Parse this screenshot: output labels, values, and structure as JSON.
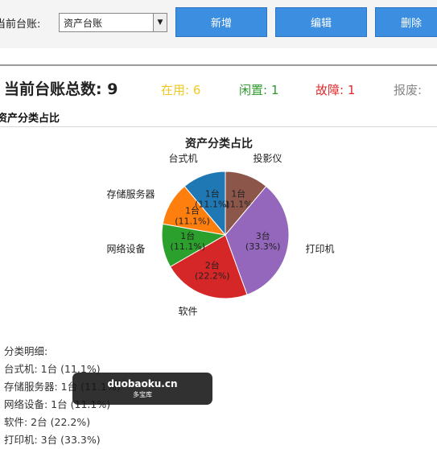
{
  "toolbar": {
    "ledger_label": "当前台账:",
    "ledger_select_value": "资产台账",
    "add_button": "新增",
    "edit_button": "编辑",
    "delete_button": "删除"
  },
  "stats": {
    "total": "当前台账总数: 9",
    "in_use": "在用: 6",
    "idle": "闲置: 1",
    "fault": "故障: 1",
    "scrap": "报废:",
    "colors": {
      "in_use": "#f2c81e",
      "idle": "#2e9a2e",
      "fault": "#e02a2a",
      "scrap": "#888888"
    }
  },
  "section_title": "资产分类占比",
  "chart_data": {
    "type": "pie",
    "title": "资产分类占比",
    "categories": [
      "投影仪",
      "打印机",
      "软件",
      "网络设备",
      "存储服务器",
      "台式机"
    ],
    "values": [
      1,
      3,
      2,
      1,
      1,
      1
    ],
    "slice_text": [
      [
        "1台",
        "(11.1%)"
      ],
      [
        "3台",
        "(33.3%)"
      ],
      [
        "2台",
        "(22.2%)"
      ],
      [
        "1台",
        "(11.1%)"
      ],
      [
        "1台",
        "(11.1%)"
      ],
      [
        "1台",
        "(11.1%)"
      ]
    ],
    "colors": [
      "#8c564b",
      "#9467bd",
      "#d62728",
      "#2ca02c",
      "#ff7f0e",
      "#1f77b4"
    ]
  },
  "detail": {
    "heading": "分类明细:",
    "lines": [
      "台式机: 1台 (11.1%)",
      "存储服务器: 1台 (11.1%)",
      "网络设备: 1台 (11.1%)",
      "软件: 2台 (22.2%)",
      "打印机: 3台 (33.3%)"
    ]
  },
  "watermark": {
    "line1": "duobaoku.cn",
    "line2": "多宝库"
  }
}
